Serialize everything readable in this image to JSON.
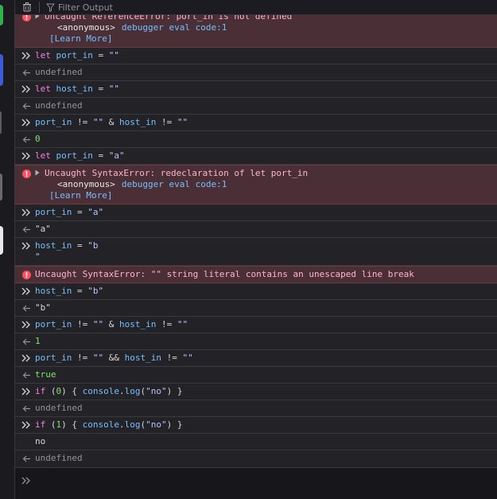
{
  "toolbar": {
    "filter_placeholder": "Filter Output"
  },
  "entries": [
    {
      "kind": "error",
      "message": "Uncaught ReferenceError: port_in is not defined",
      "stack_fn": "<anonymous>",
      "stack_loc": "debugger eval code:1",
      "learn_more": "[Learn More]"
    },
    {
      "kind": "input",
      "code": "let port_in = \"\""
    },
    {
      "kind": "result",
      "value": "undefined"
    },
    {
      "kind": "input",
      "code": "let host_in = \"\""
    },
    {
      "kind": "result",
      "value": "undefined"
    },
    {
      "kind": "input",
      "code": "port_in != \"\" & host_in != \"\""
    },
    {
      "kind": "result",
      "value": "0"
    },
    {
      "kind": "input",
      "code": "let port_in = \"a\""
    },
    {
      "kind": "error",
      "message": "Uncaught SyntaxError: redeclaration of let port_in",
      "stack_fn": "<anonymous>",
      "stack_loc": "debugger eval code:1",
      "learn_more": "[Learn More]"
    },
    {
      "kind": "input",
      "code": "port_in = \"a\""
    },
    {
      "kind": "result",
      "value": "\"a\""
    },
    {
      "kind": "input",
      "code": "host_in = \"b",
      "code_line2": "\""
    },
    {
      "kind": "error_simple",
      "message": "Uncaught SyntaxError: \"\" string literal contains an unescaped line break"
    },
    {
      "kind": "input",
      "code": "host_in = \"b\""
    },
    {
      "kind": "result",
      "value": "\"b\""
    },
    {
      "kind": "input",
      "code": "port_in != \"\" & host_in != \"\""
    },
    {
      "kind": "result",
      "value": "1"
    },
    {
      "kind": "input",
      "code": "port_in != \"\" && host_in != \"\""
    },
    {
      "kind": "result",
      "value": "true"
    },
    {
      "kind": "input",
      "code": "if (0) { console.log(\"no\") }"
    },
    {
      "kind": "result",
      "value": "undefined"
    },
    {
      "kind": "input",
      "code": "if (1) { console.log(\"no\") }"
    },
    {
      "kind": "log",
      "value": "no"
    },
    {
      "kind": "result",
      "value": "undefined"
    }
  ],
  "icons": {
    "trash": "trash-icon",
    "filter": "filter-icon",
    "prompt": "double-chevron-right-icon",
    "result_arrow": "arrow-left-icon",
    "error": "error-icon"
  },
  "colors": {
    "error_bg": "#4b2f36",
    "error_icon": "#ff4f5e",
    "link": "#75bfff",
    "number": "#86de74"
  }
}
